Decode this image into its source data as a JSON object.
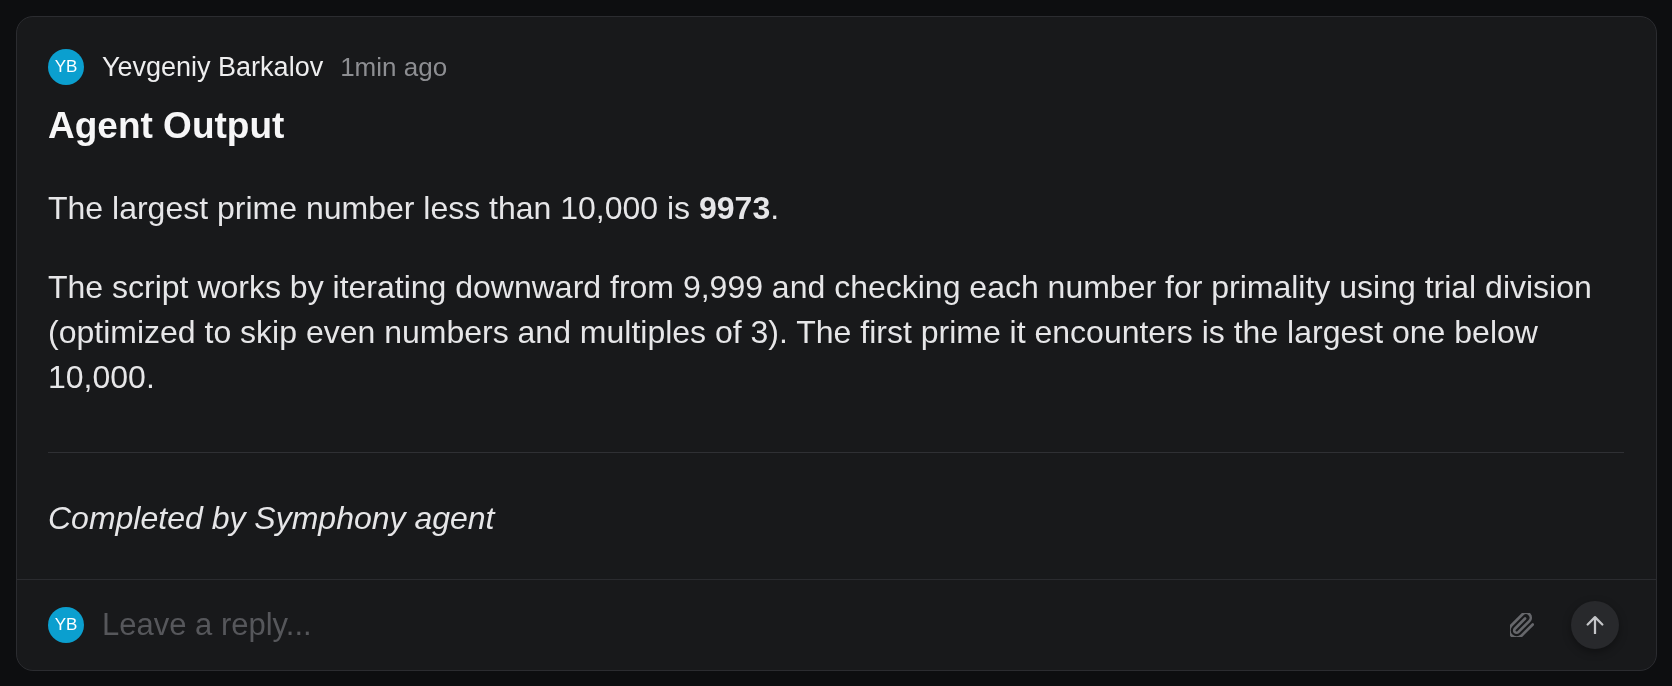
{
  "message": {
    "author": {
      "initials": "YB",
      "name": "Yevgeniy Barkalov"
    },
    "time": "1min ago",
    "title": "Agent Output",
    "paragraphs": [
      "The largest prime number less than 10,000 is **9973**.",
      "The script works by iterating downward from 9,999 and checking each number for primality using trial division (optimized to skip even numbers and multiples of 3). The first prime it encounters is the largest one below 10,000."
    ],
    "footer_note": "Completed by Symphony agent"
  },
  "reply": {
    "avatar_initials": "YB",
    "placeholder": "Leave a reply..."
  }
}
